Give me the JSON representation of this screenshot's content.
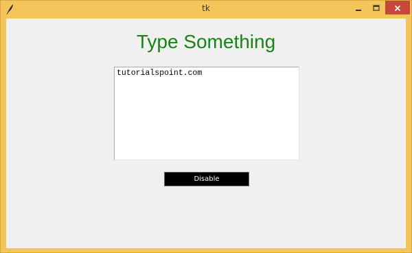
{
  "window": {
    "title": "tk",
    "icons": {
      "app": "feather-icon",
      "minimize": "minimize-icon",
      "maximize": "maximize-icon",
      "close": "close-icon"
    },
    "colors": {
      "frame": "#f3c55a",
      "close_button": "#c7473a"
    }
  },
  "main": {
    "heading": "Type Something",
    "heading_color": "#188218",
    "textbox_value": "tutorialspoint.com",
    "button_label": "Disable",
    "button_bg": "#000000",
    "button_fg": "#ffffff"
  }
}
